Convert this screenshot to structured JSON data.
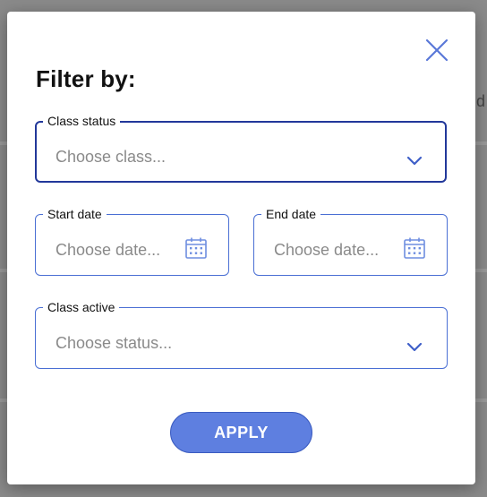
{
  "backdrop": {
    "partial_text": "d"
  },
  "modal": {
    "title": "Filter by:",
    "close_icon": "close-icon",
    "class_status": {
      "label": "Class status",
      "placeholder": "Choose class..."
    },
    "start_date": {
      "label": "Start date",
      "placeholder": "Choose date..."
    },
    "end_date": {
      "label": "End date",
      "placeholder": "Choose date..."
    },
    "class_active": {
      "label": "Class active",
      "placeholder": "Choose status..."
    },
    "apply_label": "APPLY"
  },
  "colors": {
    "accent": "#5e7fe0",
    "border": "#4a6fd4",
    "focused_border": "#22389a"
  }
}
